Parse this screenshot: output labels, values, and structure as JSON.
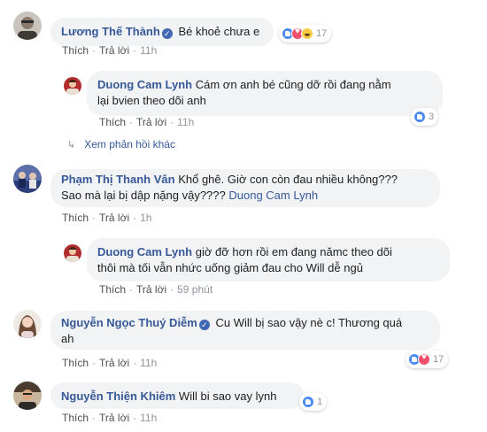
{
  "labels": {
    "like": "Thích",
    "reply": "Trả lời",
    "dot": "·"
  },
  "comments": [
    {
      "name": "Lương Thế Thành",
      "verified": true,
      "text": "Bé khoẻ chưa e",
      "time": "11h",
      "reaction_count": "17",
      "reactions": [
        "like-icon",
        "love-icon",
        "haha-icon"
      ]
    },
    {
      "name": "Duong Cam Lynh",
      "text_line1": "Cám ơn anh bé cũng dỡ rồi đang nằm",
      "text_line2": "lại bvien theo dõi anh",
      "time": "11h",
      "reaction_count": "3",
      "reactions": [
        "like-icon"
      ]
    },
    {
      "more_replies": "Xem phản hồi khác"
    },
    {
      "name": "Phạm Thị Thanh Vân",
      "text_line1": "Khổ ghê. Giờ con còn đau nhiều không???",
      "text_line2": "Sao mà lại bị dập nặng vậy????",
      "mention": "Duong Cam Lynh",
      "time": "1h"
    },
    {
      "name": "Duong Cam Lynh",
      "text_line1": "giờ đỡ hơn rồi em đang nămc theo dõi",
      "text_line2": "thôi mà tối vẫn nhức uống giảm đau cho Will dễ ngủ",
      "time": "59 phút"
    },
    {
      "name": "Nguyễn Ngọc Thuý Diễm",
      "verified": true,
      "text_line1": "Cu Will bị sao vậy nè c! Thương quá",
      "text_line2": "ah",
      "time": "11h",
      "reaction_count": "17",
      "reactions": [
        "like-icon",
        "love-icon"
      ]
    },
    {
      "name": "Nguyễn Thiện Khiêm",
      "text": "Will bi sao vay lynh",
      "time": "11h",
      "reaction_count": "1",
      "reactions": [
        "like-icon"
      ]
    }
  ]
}
